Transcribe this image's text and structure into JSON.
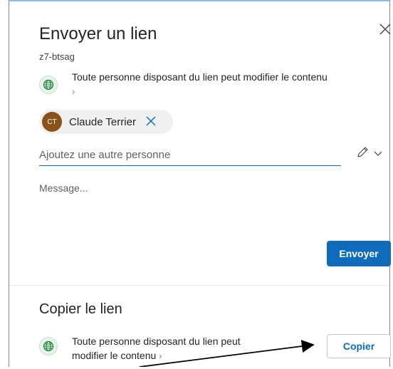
{
  "dialog": {
    "title": "Envoyer un lien",
    "subtitle": "z7-btsag",
    "close_icon": "close-icon"
  },
  "send": {
    "permission_text": "Toute personne disposant du lien peut modifier le contenu",
    "permission_chevron": "›",
    "recipients": [
      {
        "initials": "CT",
        "name": "Claude Terrier",
        "avatar_color": "#8a5217"
      }
    ],
    "add_placeholder": "Ajoutez une autre personne",
    "message_placeholder": "Message...",
    "send_label": "Envoyer"
  },
  "copy": {
    "title": "Copier le lien",
    "permission_line1": "Toute personne disposant du lien peut",
    "permission_line2": "modifier le contenu",
    "permission_chevron": "›",
    "copy_label": "Copier"
  },
  "colors": {
    "accent": "#0f6cbd",
    "globe_bg": "#e8f4ea",
    "globe_stroke": "#1a7f37"
  }
}
